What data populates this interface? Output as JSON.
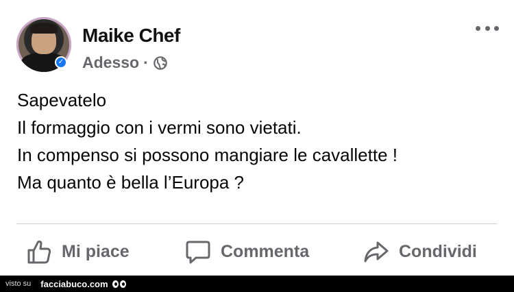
{
  "post": {
    "author": "Maike Chef",
    "timestamp": "Adesso",
    "separator": "·",
    "privacy_icon": "globe-icon",
    "more_icon": "more-options-icon",
    "text_lines": [
      "Sapevatelo",
      "Il formaggio con i vermi sono vietati.",
      "In compenso si possono mangiare le cavallette !",
      "Ma quanto è bella l’Europa ?"
    ]
  },
  "actions": {
    "like_label": "Mi piace",
    "comment_label": "Commenta",
    "share_label": "Condividi"
  },
  "footer": {
    "seen_on": "visto su",
    "site": "facciabuco.com"
  },
  "colors": {
    "text": "#050505",
    "secondary": "#65676b",
    "divider": "#ced0d4",
    "verified": "#1877f2",
    "footer_bg": "#000000"
  }
}
